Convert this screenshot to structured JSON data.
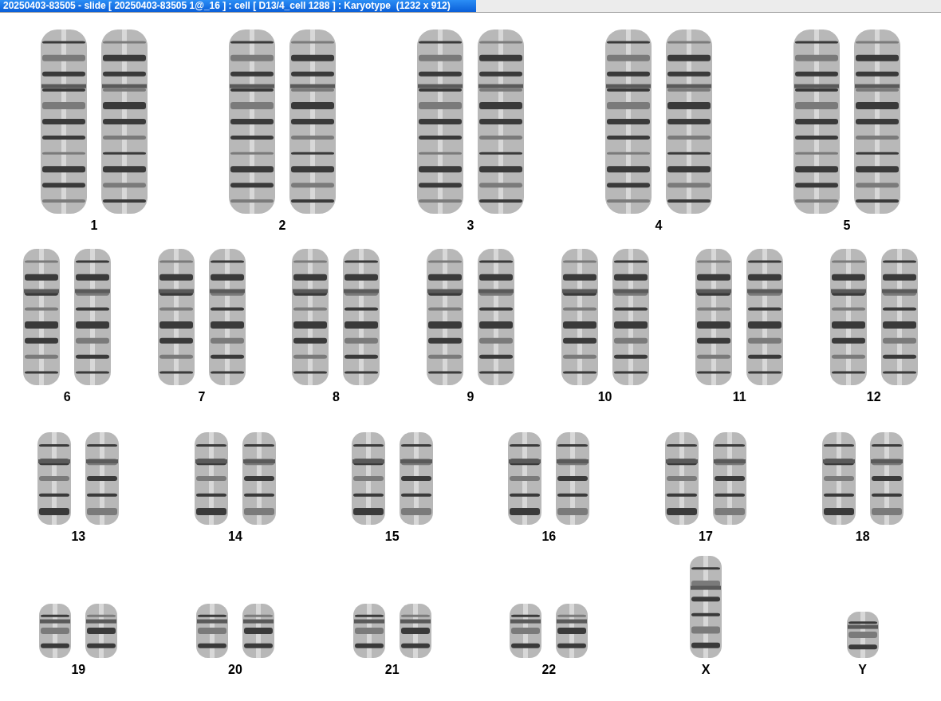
{
  "window": {
    "title": "20250403-83505 - slide [ 20250403-83505 1@_16 ] : cell [ D13/4_cell 1288 ] : Karyotype  (1232 x 912)"
  },
  "karyotype": {
    "rows": [
      {
        "groups": [
          {
            "label": "1",
            "kind": "pair"
          },
          {
            "label": "2",
            "kind": "pair"
          },
          {
            "label": "3",
            "kind": "pair"
          },
          {
            "label": "4",
            "kind": "pair"
          },
          {
            "label": "5",
            "kind": "pair"
          }
        ]
      },
      {
        "groups": [
          {
            "label": "6",
            "kind": "pair"
          },
          {
            "label": "7",
            "kind": "pair"
          },
          {
            "label": "8",
            "kind": "pair"
          },
          {
            "label": "9",
            "kind": "pair"
          },
          {
            "label": "10",
            "kind": "pair"
          },
          {
            "label": "11",
            "kind": "pair"
          },
          {
            "label": "12",
            "kind": "pair"
          }
        ]
      },
      {
        "groups": [
          {
            "label": "13",
            "kind": "pair"
          },
          {
            "label": "14",
            "kind": "pair"
          },
          {
            "label": "15",
            "kind": "pair"
          },
          {
            "label": "16",
            "kind": "pair"
          },
          {
            "label": "17",
            "kind": "pair"
          },
          {
            "label": "18",
            "kind": "pair"
          }
        ]
      },
      {
        "groups": [
          {
            "label": "19",
            "kind": "pair"
          },
          {
            "label": "20",
            "kind": "pair"
          },
          {
            "label": "21",
            "kind": "pair"
          },
          {
            "label": "22",
            "kind": "pair"
          },
          {
            "label": "X",
            "kind": "single"
          },
          {
            "label": "Y",
            "kind": "single"
          }
        ]
      }
    ]
  }
}
